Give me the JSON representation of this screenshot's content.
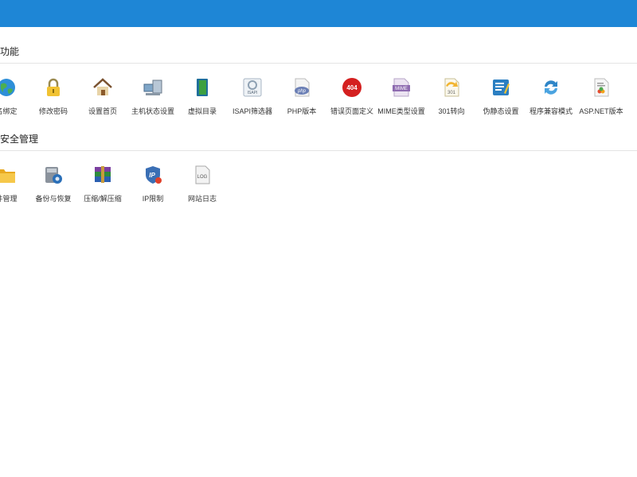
{
  "sections": [
    {
      "title": "功能",
      "items": [
        {
          "label": "名绑定",
          "icon": "globe-icon"
        },
        {
          "label": "修改密码",
          "icon": "lock-icon"
        },
        {
          "label": "设置首页",
          "icon": "home-icon"
        },
        {
          "label": "主机状态设置",
          "icon": "computer-icon"
        },
        {
          "label": "虚拟目录",
          "icon": "folder-book-icon"
        },
        {
          "label": "ISAPI筛选器",
          "icon": "isapi-icon",
          "icon_text": "ISAPI"
        },
        {
          "label": "PHP版本",
          "icon": "php-icon",
          "icon_text": "php"
        },
        {
          "label": "错误页面定义",
          "icon": "error-404-icon",
          "icon_text": "404"
        },
        {
          "label": "MIME类型设置",
          "icon": "mime-icon",
          "icon_text": "MIME"
        },
        {
          "label": "301转向",
          "icon": "redirect-301-icon",
          "icon_text": "301"
        },
        {
          "label": "伪静态设置",
          "icon": "rewrite-icon"
        },
        {
          "label": "程序兼容模式",
          "icon": "refresh-icon"
        },
        {
          "label": "ASP.NET版本",
          "icon": "aspnet-icon"
        }
      ]
    },
    {
      "title": "安全管理",
      "items": [
        {
          "label": "件管理",
          "icon": "folder-icon"
        },
        {
          "label": "备份与恢复",
          "icon": "backup-icon"
        },
        {
          "label": "压缩/解压缩",
          "icon": "archive-icon"
        },
        {
          "label": "IP限制",
          "icon": "ip-shield-icon",
          "icon_text": "IP"
        },
        {
          "label": "网站日志",
          "icon": "log-icon",
          "icon_text": "LOG"
        }
      ]
    }
  ],
  "colors": {
    "topbar": "#1e86d6"
  }
}
